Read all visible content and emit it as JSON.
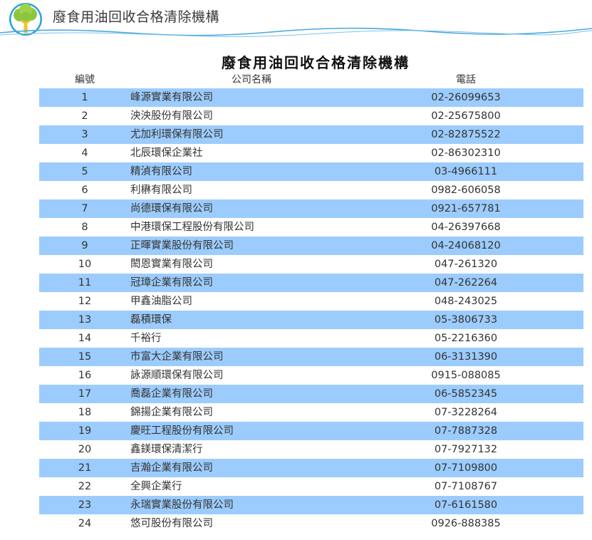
{
  "header": {
    "title": "廢食用油回收合格清除機構"
  },
  "page_title": "廢食用油回收合格清除機構",
  "columns": {
    "no": "編號",
    "name": "公司名稱",
    "tel": "電話"
  },
  "rows": [
    {
      "no": "1",
      "name": "峰源實業有限公司",
      "tel": "02-26099653"
    },
    {
      "no": "2",
      "name": "泱泱股份有限公司",
      "tel": "02-25675800"
    },
    {
      "no": "3",
      "name": "尤加利環保有限公司",
      "tel": "02-82875522"
    },
    {
      "no": "4",
      "name": "北辰環保企業社",
      "tel": "02-86302310"
    },
    {
      "no": "5",
      "name": "精湞有限公司",
      "tel": "03-4966111"
    },
    {
      "no": "6",
      "name": "利楙有限公司",
      "tel": "0982-606058"
    },
    {
      "no": "7",
      "name": "尚德環保有限公司",
      "tel": "0921-657781"
    },
    {
      "no": "8",
      "name": "中港環保工程股份有限公司",
      "tel": "04-26397668"
    },
    {
      "no": "9",
      "name": "正暉實業股份有限公司",
      "tel": "04-24068120"
    },
    {
      "no": "10",
      "name": "閎恩實業有限公司",
      "tel": "047-261320"
    },
    {
      "no": "11",
      "name": "冠璋企業有限公司",
      "tel": "047-262264"
    },
    {
      "no": "12",
      "name": "甲鑫油脂公司",
      "tel": "048-243025"
    },
    {
      "no": "13",
      "name": "磊積環保",
      "tel": "05-3806733"
    },
    {
      "no": "14",
      "name": "千裕行",
      "tel": "05-2216360"
    },
    {
      "no": "15",
      "name": "市富大企業有限公司",
      "tel": "06-3131390"
    },
    {
      "no": "16",
      "name": "詠源順環保有限公司",
      "tel": "0915-088085"
    },
    {
      "no": "17",
      "name": "喬磊企業有限公司",
      "tel": "06-5852345"
    },
    {
      "no": "18",
      "name": "錦揚企業有限公司",
      "tel": "07-3228264"
    },
    {
      "no": "19",
      "name": "慶旺工程股份有限公司",
      "tel": "07-7887328"
    },
    {
      "no": "20",
      "name": "鑫鎂環保清潔行",
      "tel": "07-7927132"
    },
    {
      "no": "21",
      "name": "吉瀚企業有限公司",
      "tel": "07-7109800"
    },
    {
      "no": "22",
      "name": "全興企業行",
      "tel": "07-7108767"
    },
    {
      "no": "23",
      "name": "永瑞實業股份有限公司",
      "tel": "07-6161580"
    },
    {
      "no": "24",
      "name": "悠可股份有限公司",
      "tel": "0926-888385"
    }
  ],
  "colors": {
    "row_shade": "#9cccfd",
    "wave": "#4aa8dc",
    "tree_leaf": "#8cc63f",
    "tree_circle": "#29a3d8"
  },
  "icons": {
    "logo": "tree-logo-icon"
  }
}
